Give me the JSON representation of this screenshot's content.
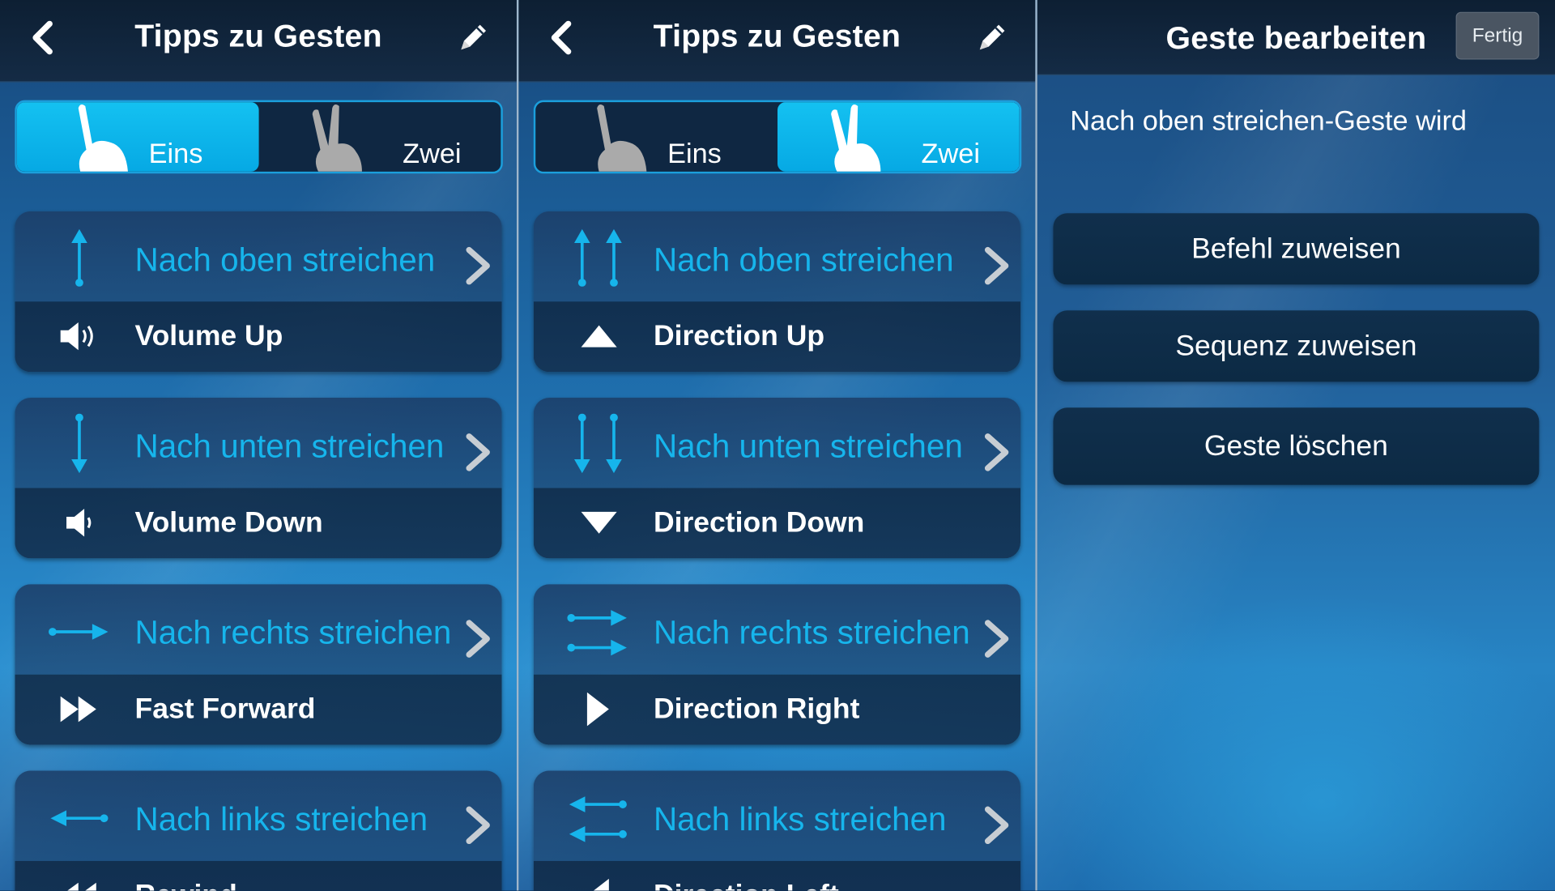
{
  "panels": [
    {
      "title": "Tipps zu Gesten",
      "segments": [
        "Eins",
        "Zwei"
      ],
      "active_segment": "Eins",
      "gestures": [
        {
          "gesture": "Nach oben streichen",
          "command": "Volume Up",
          "gesture_icon": "arrow-up-icon",
          "command_icon": "speaker-loud-icon"
        },
        {
          "gesture": "Nach unten streichen",
          "command": "Volume Down",
          "gesture_icon": "arrow-down-icon",
          "command_icon": "speaker-icon"
        },
        {
          "gesture": "Nach rechts streichen",
          "command": "Fast Forward",
          "gesture_icon": "arrow-right-icon",
          "command_icon": "fast-forward-icon"
        },
        {
          "gesture": "Nach links streichen",
          "command": "Rewind",
          "gesture_icon": "arrow-left-icon",
          "command_icon": "rewind-icon"
        }
      ]
    },
    {
      "title": "Tipps zu Gesten",
      "segments": [
        "Eins",
        "Zwei"
      ],
      "active_segment": "Zwei",
      "gestures": [
        {
          "gesture": "Nach oben streichen",
          "command": "Direction Up",
          "gesture_icon": "double-arrow-up-icon",
          "command_icon": "triangle-up-icon"
        },
        {
          "gesture": "Nach unten streichen",
          "command": "Direction Down",
          "gesture_icon": "double-arrow-down-icon",
          "command_icon": "triangle-down-icon"
        },
        {
          "gesture": "Nach rechts streichen",
          "command": "Direction Right",
          "gesture_icon": "double-arrow-right-icon",
          "command_icon": "triangle-right-icon"
        },
        {
          "gesture": "Nach links streichen",
          "command": "Direction Left",
          "gesture_icon": "double-arrow-left-icon",
          "command_icon": "triangle-left-icon"
        }
      ]
    }
  ],
  "edit_panel": {
    "title": "Geste bearbeiten",
    "done_label": "Fertig",
    "description": "Nach oben streichen-Geste wird",
    "buttons": [
      "Befehl zuweisen",
      "Sequenz zuweisen",
      "Geste löschen"
    ]
  },
  "colors": {
    "accent": "#07abe6",
    "gesture_text": "#16b5ec",
    "navbar": "#0f2338"
  }
}
